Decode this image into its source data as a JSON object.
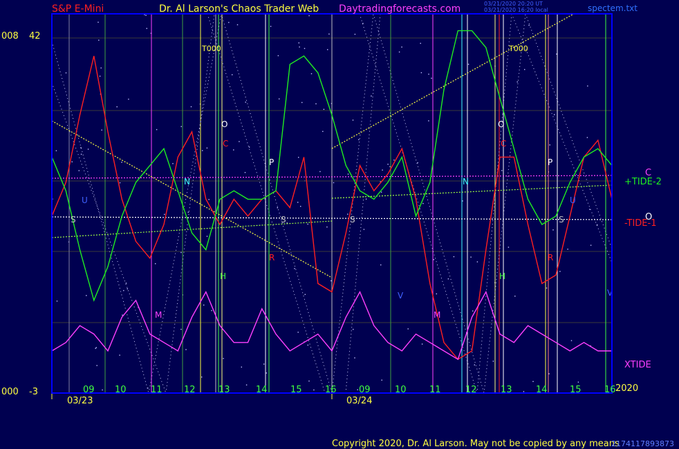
{
  "header": {
    "symbol": "S&P E-Mini",
    "title": "Dr. Al Larson's Chaos Trader Web",
    "site": "Daytradingforecasts.com",
    "stamp1": "03/21/2020 20:20 UT",
    "stamp2": "03/21/2020 16:20 local",
    "file": "spectem.txt"
  },
  "axis": {
    "left_top_a": "008",
    "left_top_b": "42",
    "left_bot_a": "000",
    "left_bot_b": "-3",
    "hours": [
      "09",
      "10",
      "11",
      "12",
      "13",
      "14",
      "15",
      "16",
      "09",
      "10",
      "11",
      "12",
      "13",
      "14",
      "15",
      "16"
    ],
    "dates": [
      "03/23",
      "03/24"
    ],
    "year": "2020"
  },
  "labels": {
    "tidem2": "+TIDE-2",
    "tidem1": "-TIDE-1",
    "c": "C",
    "o": "O",
    "xtide": "XTIDE",
    "t000": "T000",
    "copyright": "Copyright 2020, Dr. Al Larson. May not be copied by any means",
    "footer_code": "2174117893873"
  },
  "markers": {
    "O": "O",
    "C": "C",
    "P": "P",
    "R": "R",
    "S": "S",
    "H": "H",
    "N": "N",
    "M": "M",
    "V": "V",
    "U": "U"
  },
  "colors": {
    "bg": "#000050",
    "plot_border": "#0000ff",
    "tide1": "#ff2020",
    "tide2": "#20ee20",
    "xtide": "#ff40ff",
    "white_line": "#ffffff",
    "yellow_line": "#ffff00",
    "c_line": "#ff40ff"
  },
  "chart_data": {
    "type": "line",
    "title": "S&P E-Mini",
    "ylim": [
      -3,
      42
    ],
    "x_categories": [
      "03/23 09",
      "10",
      "11",
      "12",
      "13",
      "14",
      "15",
      "16",
      "03/24 09",
      "10",
      "11",
      "12",
      "13",
      "14",
      "15",
      "16"
    ],
    "series": [
      {
        "name": "-TIDE-1",
        "color": "#ff2020",
        "values": [
          18,
          22,
          30,
          37,
          28,
          20,
          15,
          13,
          17,
          25,
          28,
          20,
          17,
          20,
          18,
          20,
          21,
          19,
          25,
          10,
          9,
          16,
          24,
          21,
          23,
          26,
          20,
          10,
          3,
          1,
          2,
          14,
          25,
          25,
          17,
          10,
          11,
          18,
          25,
          27,
          20
        ]
      },
      {
        "name": "+TIDE-2",
        "color": "#20ee20",
        "values": [
          25,
          21,
          14,
          8,
          12,
          18,
          22,
          24,
          26,
          21,
          16,
          14,
          20,
          21,
          20,
          20,
          21,
          36,
          37,
          35,
          30,
          24,
          21,
          20,
          22,
          25,
          18,
          22,
          33,
          40,
          40,
          38,
          32,
          26,
          20,
          17,
          18,
          22,
          25,
          26,
          24
        ]
      },
      {
        "name": "XTIDE",
        "color": "#ff40ff",
        "values": [
          2,
          3,
          5,
          4,
          2,
          6,
          8,
          4,
          3,
          2,
          6,
          9,
          5,
          3,
          3,
          7,
          4,
          2,
          3,
          4,
          2,
          6,
          9,
          5,
          3,
          2,
          4,
          3,
          2,
          1,
          6,
          9,
          4,
          3,
          5,
          4,
          3,
          2,
          3,
          2,
          2
        ]
      }
    ],
    "annotations": [
      "T000",
      "T000",
      "O",
      "O",
      "C",
      "C",
      "P",
      "P",
      "R",
      "R",
      "S",
      "S",
      "H",
      "H",
      "N",
      "N",
      "M",
      "M",
      "V",
      "V",
      "U",
      "U",
      "+TIDE-2",
      "-TIDE-1",
      "XTIDE"
    ]
  }
}
